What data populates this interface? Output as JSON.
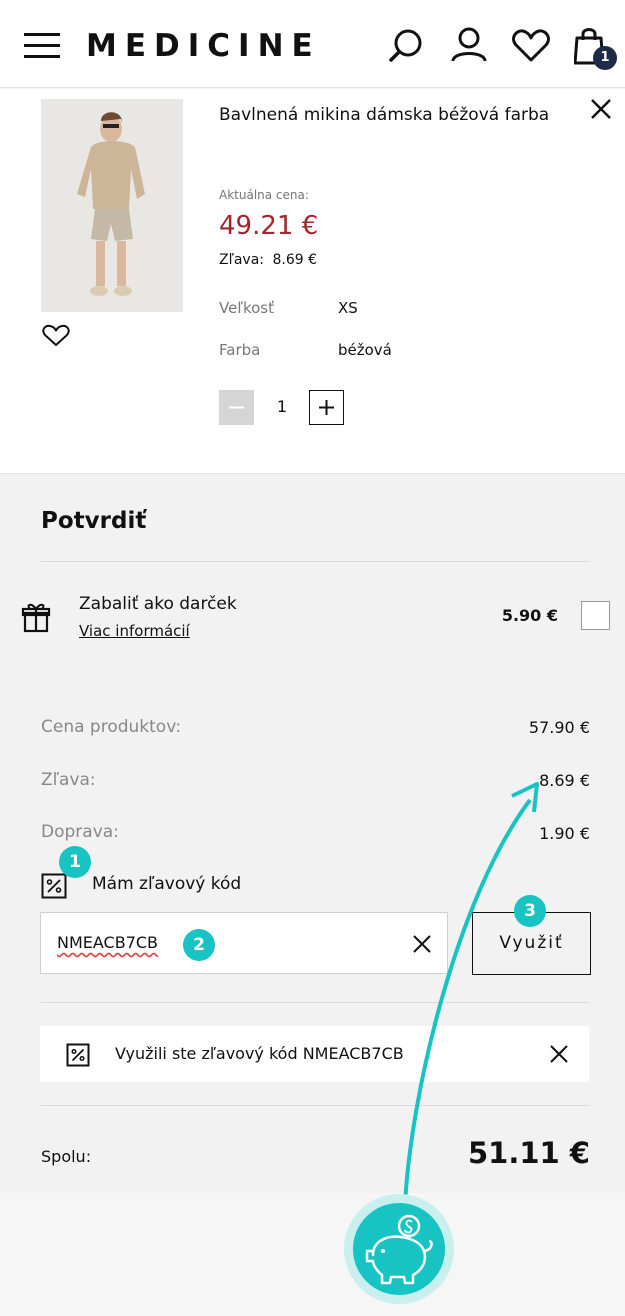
{
  "header": {
    "logo": "MEDICINE",
    "cart_count": "1",
    "icons": [
      "menu-icon",
      "search-icon",
      "account-icon",
      "heart-icon",
      "bag-icon"
    ]
  },
  "product": {
    "title": "Bavlnená mikina dámska béžová farba",
    "current_price_label": "Aktuálna cena:",
    "current_price": "49.21 €",
    "discount_label": "Zľava:",
    "discount_value": "8.69 €",
    "size_label": "Veľkosť",
    "size_value": "XS",
    "color_label": "Farba",
    "color_value": "béžová",
    "quantity": "1"
  },
  "summary": {
    "title": "Potvrdiť",
    "gift_label": "Zabaliť ako darček",
    "gift_link": "Viac informácií",
    "gift_price": "5.90 €",
    "products_price_label": "Cena produktov:",
    "products_price": "57.90 €",
    "discount_label": "Zľava:",
    "discount": "8.69 €",
    "shipping_label": "Doprava:",
    "shipping": "1.90 €",
    "code_label": "Mám zľavový kód",
    "code_value": "NMEACB7CB",
    "apply_button": "Využiť",
    "applied_message": "Využili ste zľavový kód NMEACB7CB",
    "total_label": "Spolu:",
    "total": "51.11 €"
  },
  "annotations": {
    "step1": "1",
    "step2": "2",
    "step3": "3"
  },
  "colors": {
    "price_red": "#a3262a",
    "accent_teal": "#17c3c3",
    "badge_navy": "#1e2a4a"
  }
}
